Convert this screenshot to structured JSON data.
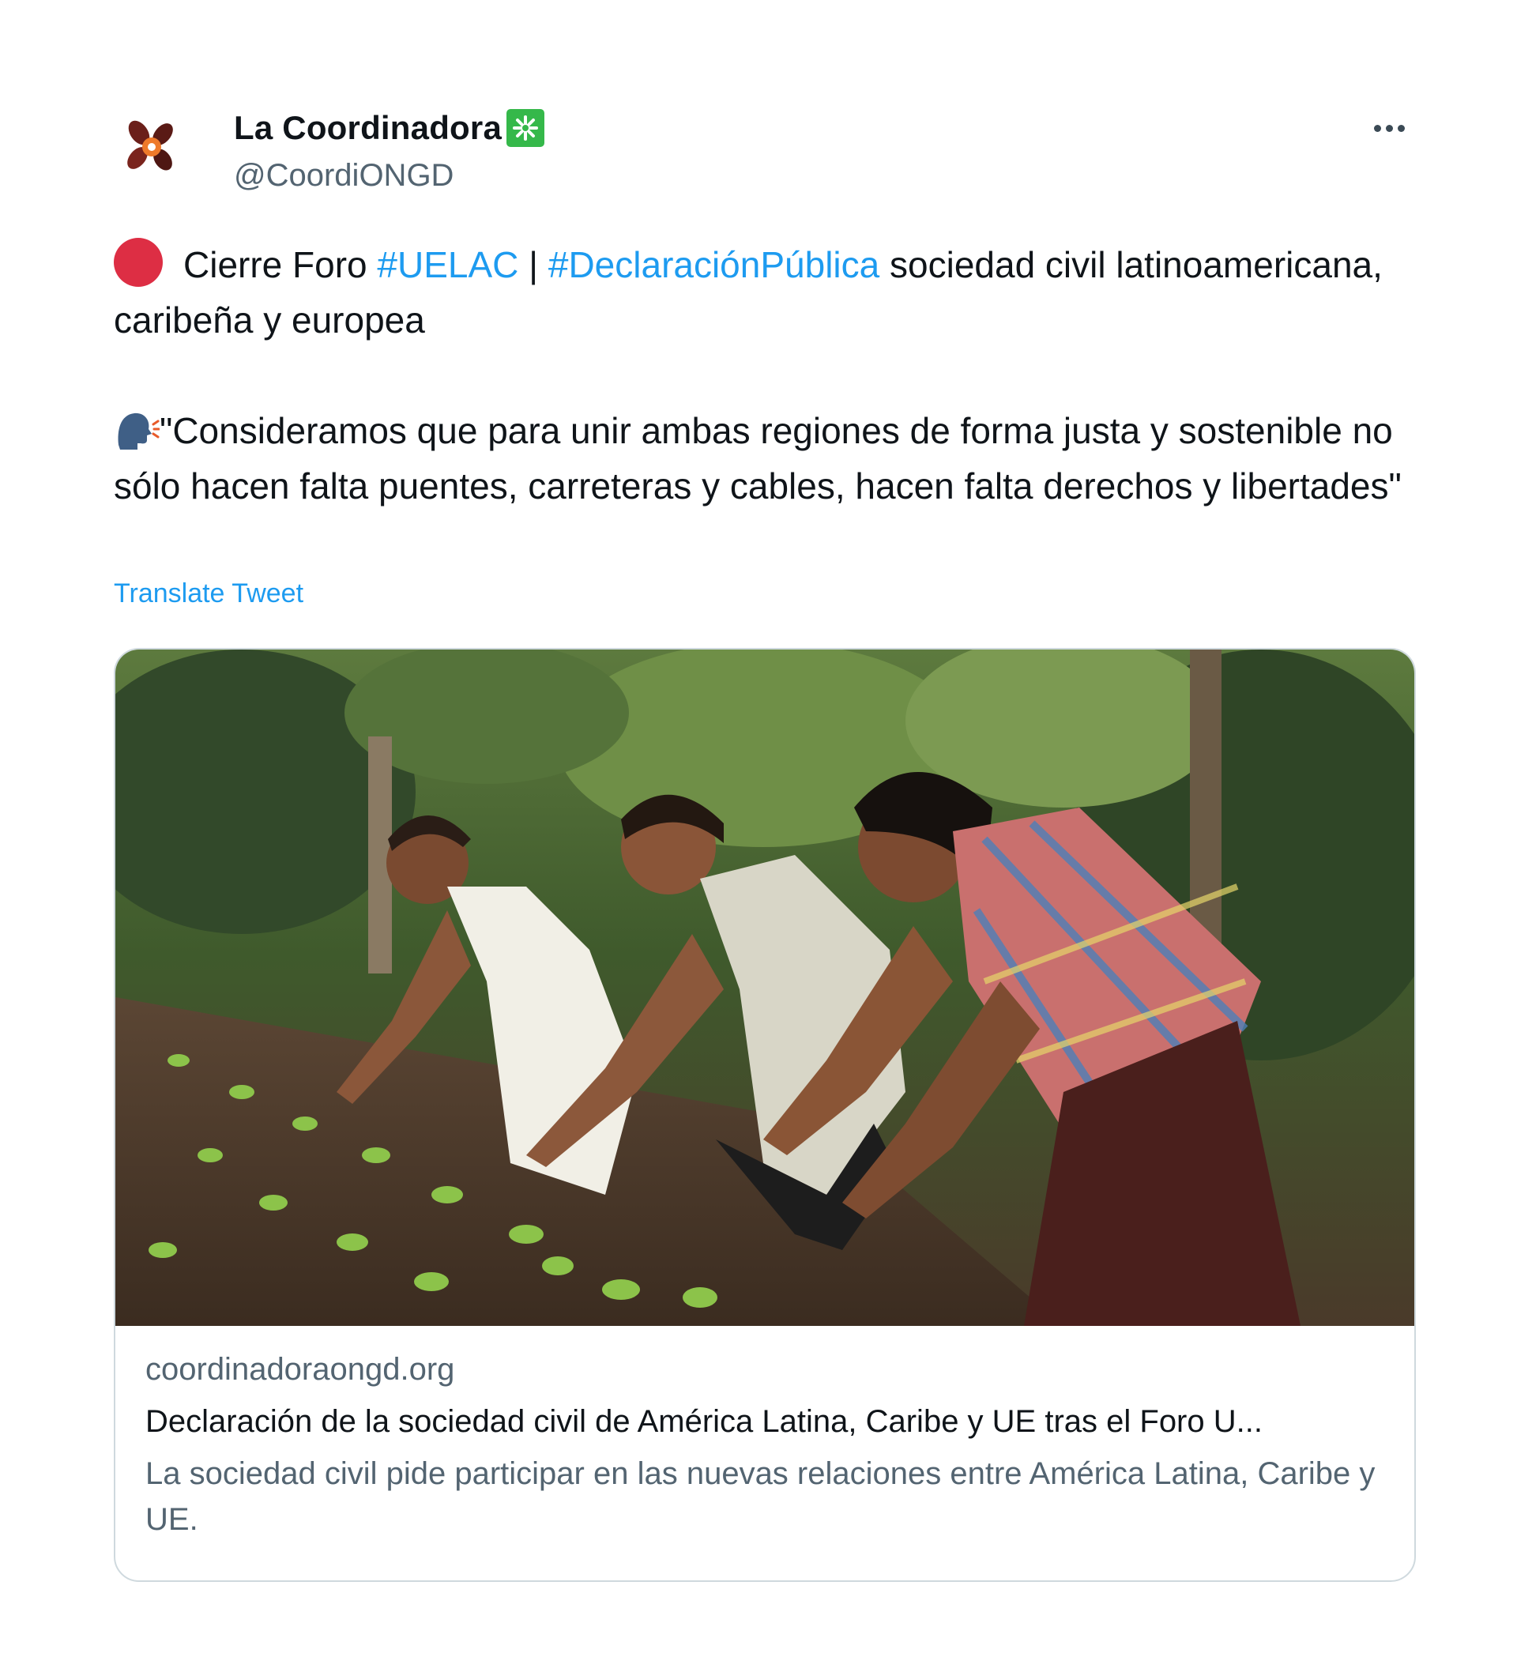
{
  "author": {
    "display_name": "La Coordinadora",
    "handle": "@CoordiONGD"
  },
  "icons": {
    "avatar": "coordinadora-logo",
    "verified": "sparkle-badge",
    "more": "more-horizontal-icon",
    "alert": "red-circle-emoji",
    "speaker": "speaking-head-emoji"
  },
  "tweet": {
    "line1_prefix": "Cierre Foro",
    "hashtag1": "#UELAC",
    "separator": "|",
    "hashtag2": "#DeclaraciónPública",
    "line1_suffix": "sociedad civil latinoamericana, caribeña y europea",
    "quote": "\"Consideramos que para unir ambas regiones de forma justa y sostenible no sólo hacen falta puentes, carreteras y cables, hacen falta derechos y libertades\"",
    "translate_label": "Translate Tweet"
  },
  "card": {
    "domain": "coordinadoraongd.org",
    "title": "Declaración de la sociedad civil de América Latina, Caribe y UE tras el Foro U...",
    "description": "La sociedad civil pide participar en las nuevas relaciones entre América Latina, Caribe y UE."
  },
  "colors": {
    "link": "#1d9bf0",
    "text": "#0f1419",
    "secondary": "#536471",
    "border": "#cfd9de",
    "verified": "#35b84a",
    "alert": "#dd2e44"
  }
}
